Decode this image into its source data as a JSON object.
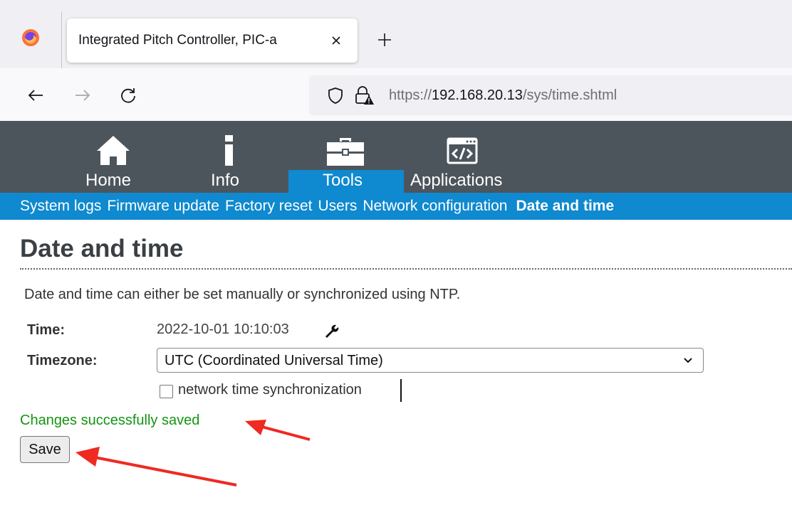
{
  "browser": {
    "tab_title": "Integrated Pitch Controller, PIC-a",
    "url_scheme": "https://",
    "url_host": "192.168.20.13",
    "url_path": "/sys/time.shtml",
    "icons": [
      "firefox-logo-icon",
      "close-icon",
      "plus-icon",
      "back-arrow-icon",
      "forward-arrow-icon",
      "reload-icon",
      "shield-icon",
      "lock-warning-icon"
    ]
  },
  "app_nav": {
    "items": [
      {
        "label": "Home",
        "icon": "home-icon"
      },
      {
        "label": "Info",
        "icon": "info-icon"
      },
      {
        "label": "Tools",
        "icon": "toolbox-icon",
        "active": true
      },
      {
        "label": "Applications",
        "icon": "code-window-icon"
      }
    ]
  },
  "sub_nav": {
    "items": [
      {
        "label": "System logs"
      },
      {
        "label": "Firmware update"
      },
      {
        "label": "Factory reset"
      },
      {
        "label": "Users"
      },
      {
        "label": "Network configuration"
      },
      {
        "label": "Date and time",
        "active": true
      }
    ]
  },
  "page": {
    "title": "Date and time",
    "intro": "Date and time can either be set manually or synchronized using NTP.",
    "time_label": "Time:",
    "time_value": "2022-10-01 10:10:03",
    "timezone_label": "Timezone:",
    "timezone_value": "UTC (Coordinated Universal Time)",
    "ntp_label": "network time synchronization",
    "ntp_checked": false,
    "success_message": "Changes successfully saved",
    "save_label": "Save"
  },
  "colors": {
    "header_bg": "#4d555c",
    "accent_blue": "#0f89cf",
    "success_green": "#149414",
    "annotation_red": "#ee2a22"
  }
}
